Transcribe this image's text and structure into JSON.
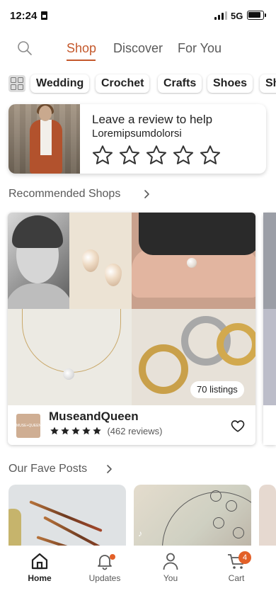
{
  "status_bar": {
    "time": "12:24",
    "network": "5G"
  },
  "top_nav": {
    "tabs": [
      {
        "label": "Shop",
        "active": true
      },
      {
        "label": "Discover",
        "active": false
      },
      {
        "label": "For You",
        "active": false
      }
    ],
    "accent_color": "#c4582b",
    "icons": [
      "search-icon"
    ]
  },
  "categories": [
    "Wedding",
    "Crochet",
    "Crafts",
    "Shoes",
    "Sh"
  ],
  "review_prompt": {
    "title": "Leave a review to help",
    "subtitle": "Loremipsumdolorsi",
    "star_count": 5
  },
  "recommended": {
    "heading": "Recommended Shops",
    "shop": {
      "name": "MuseandQueen",
      "rating": 5,
      "reviews": "(462 reviews)",
      "listings": "70 listings",
      "logo_text": "MUSE+QUEEN"
    }
  },
  "fave_posts": {
    "heading": "Our Fave Posts",
    "tiktok_mark": "♪"
  },
  "tab_bar": {
    "items": [
      {
        "label": "Home",
        "icon": "home-icon",
        "active": true
      },
      {
        "label": "Updates",
        "icon": "bell-icon",
        "active": false
      },
      {
        "label": "You",
        "icon": "person-icon",
        "active": false
      },
      {
        "label": "Cart",
        "icon": "cart-icon",
        "active": false
      }
    ],
    "cart_count": "4",
    "badge_color": "#e36028"
  }
}
